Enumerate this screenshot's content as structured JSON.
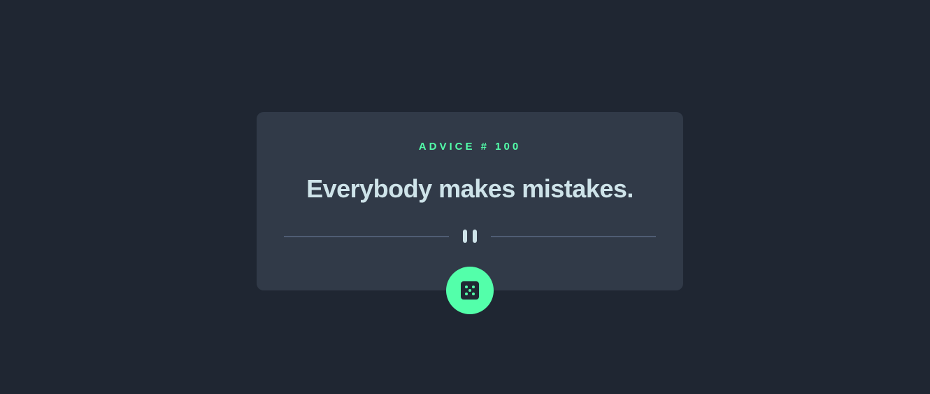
{
  "advice": {
    "label": "ADVICE # 100",
    "quote": "Everybody makes mistakes."
  },
  "icons": {
    "divider": "pause-icon",
    "button": "dice-icon"
  },
  "colors": {
    "background": "#1f2632",
    "card": "#313a48",
    "accent": "#53ffaa",
    "quote": "#cee3e9",
    "divider": "#4f5d74"
  }
}
